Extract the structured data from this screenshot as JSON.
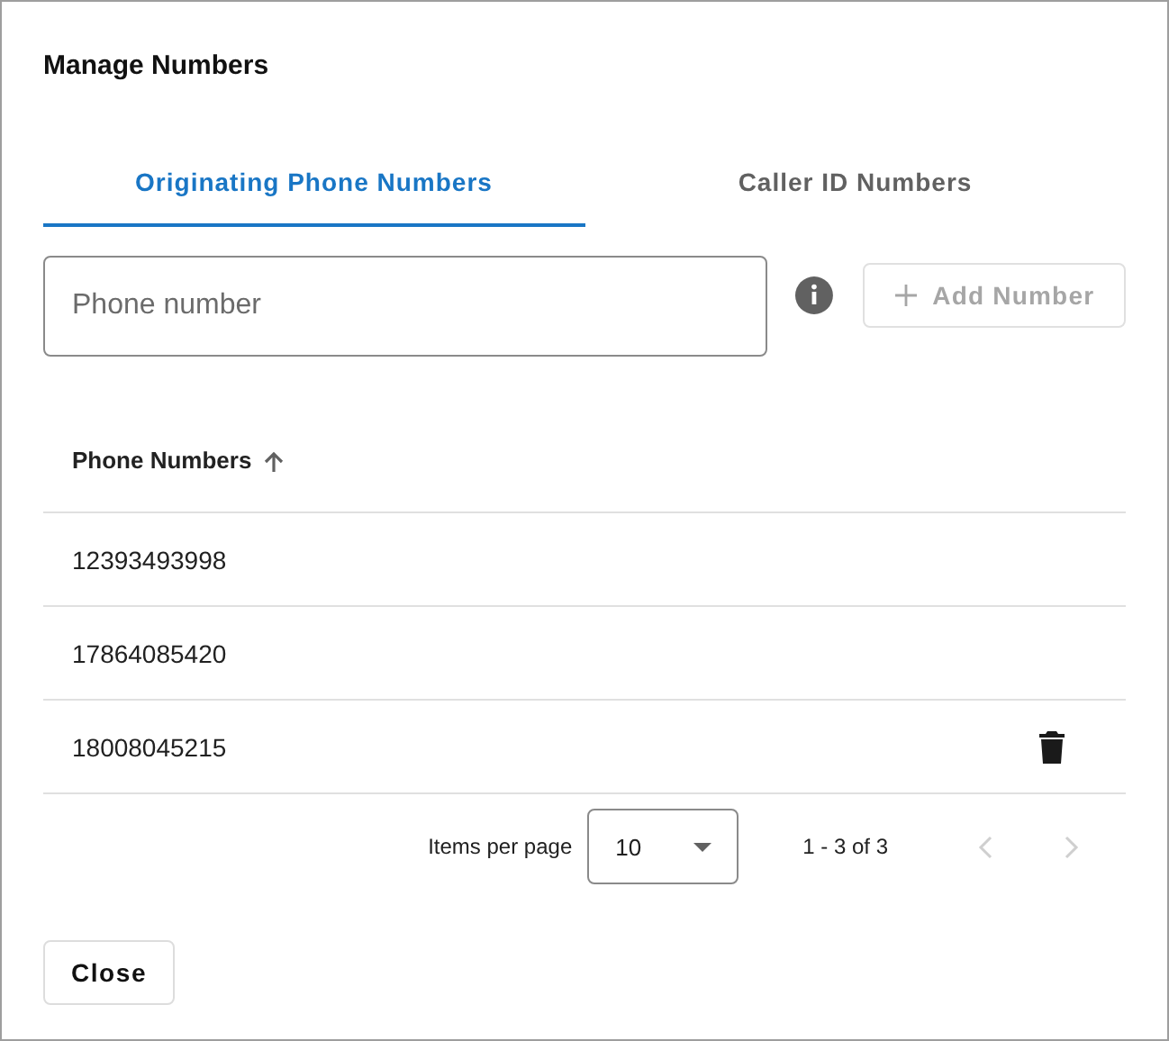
{
  "dialog": {
    "title": "Manage Numbers"
  },
  "tabs": [
    {
      "label": "Originating Phone Numbers",
      "selected": true
    },
    {
      "label": "Caller ID Numbers",
      "selected": false
    }
  ],
  "phone_field": {
    "placeholder": "Phone number"
  },
  "add_button": {
    "label": "Add Number",
    "disabled": true
  },
  "table": {
    "column": {
      "label": "Phone Numbers",
      "sorted_ascending": true
    },
    "rows": [
      {
        "number": "12393493998",
        "delete_visible": false
      },
      {
        "number": "17864085420",
        "delete_visible": false
      },
      {
        "number": "18008045215",
        "delete_visible": true
      }
    ]
  },
  "paginator": {
    "items_per_page_label": "Items per page",
    "page_size": "10",
    "range": "1 - 3 of 3",
    "previous_disabled": true,
    "next_disabled": true
  },
  "close_button": {
    "label": "Close"
  }
}
